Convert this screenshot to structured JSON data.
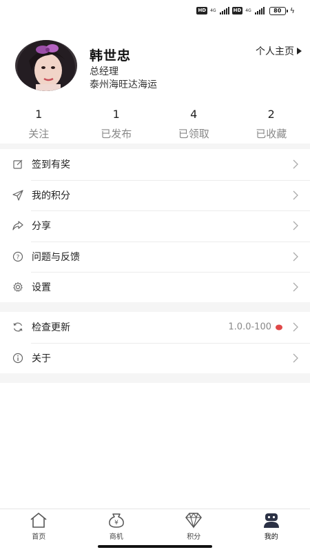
{
  "status_bar": {
    "hd1": "HD",
    "net1_top": "4G",
    "net1_bottom": "ıl",
    "hd2": "HD",
    "net2_top": "4G",
    "battery_level": "80",
    "battery_color": "#7fe04a"
  },
  "profile": {
    "name": "韩世忠",
    "role": "总经理",
    "company": "泰州海旺达海运",
    "homepage_link": "个人主页"
  },
  "stats": [
    {
      "value": "1",
      "label": "关注"
    },
    {
      "value": "1",
      "label": "已发布"
    },
    {
      "value": "4",
      "label": "已领取"
    },
    {
      "value": "2",
      "label": "已收藏"
    }
  ],
  "menu_group1": [
    {
      "label": "签到有奖",
      "icon": "edit-icon"
    },
    {
      "label": "我的积分",
      "icon": "send-icon"
    },
    {
      "label": "分享",
      "icon": "share-icon"
    },
    {
      "label": "问题与反馈",
      "icon": "help-circle-icon"
    },
    {
      "label": "设置",
      "icon": "gear-icon"
    }
  ],
  "menu_group2": [
    {
      "label": "检查更新",
      "icon": "refresh-icon",
      "extra": "1.0.0-100"
    },
    {
      "label": "关于",
      "icon": "info-icon"
    }
  ],
  "tabs": [
    {
      "label": "首页",
      "icon": "home-icon"
    },
    {
      "label": "商机",
      "icon": "yen-bag-icon"
    },
    {
      "label": "积分",
      "icon": "diamond-icon"
    },
    {
      "label": "我的",
      "icon": "user-icon"
    }
  ],
  "colors": {
    "accent_red_dot": "#e04848",
    "section_gap": "#f5f5f5"
  }
}
